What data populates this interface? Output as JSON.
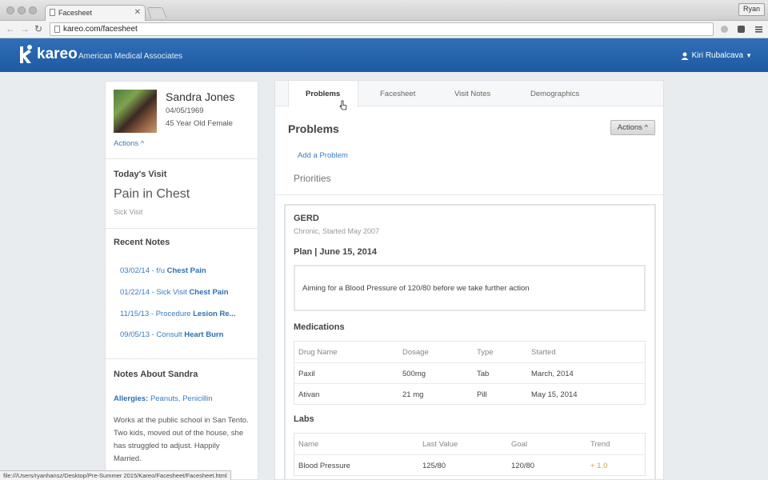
{
  "browser": {
    "tab_title": "Facesheet",
    "url": "kareo.com/facesheet",
    "profile": "Ryan",
    "status_url": "file:///Users/ryanhansz/Desktop/Pre-Summer 2015/Kareo/Facesheet/Facesheet.html"
  },
  "header": {
    "logo": "kareo",
    "practice": "American Medical Associates",
    "user": "Kiri Rubalcava"
  },
  "patient": {
    "name": "Sandra Jones",
    "dob": "04/05/1969",
    "info": "45 Year Old Female",
    "actions_label": "Actions ^"
  },
  "todays_visit": {
    "heading": "Today's Visit",
    "reason": "Pain in Chest",
    "type": "Sick Visit"
  },
  "recent_notes": {
    "heading": "Recent Notes",
    "items": [
      {
        "prefix": "03/02/14 - f/u ",
        "bold": "Chest Pain"
      },
      {
        "prefix": "01/22/14 - Sick Visit ",
        "bold": "Chest Pain"
      },
      {
        "prefix": "11/15/13 - Procedure ",
        "bold": "Lesion Re..."
      },
      {
        "prefix": "09/05/13 - Consult ",
        "bold": "Heart Burn"
      }
    ]
  },
  "notes_about": {
    "heading": "Notes About Sandra",
    "allergies_label": "Allergies:",
    "allergies_value": "Peanuts, Penicillin",
    "text": "Works at the public school in San Tento. Two kids, moved out of the house, she has struggled to adjust. Happily Married."
  },
  "tabs": [
    "Problems",
    "Facesheet",
    "Visit Notes",
    "Demographics"
  ],
  "main": {
    "title": "Problems",
    "actions_label": "Actions ^",
    "add_problem": "Add a Problem",
    "priorities": "Priorities"
  },
  "problem": {
    "name": "GERD",
    "sub": "Chronic, Started May 2007",
    "plan_title": "Plan | June 15, 2014",
    "plan_text": "Aiming for a Blood Pressure of 120/80 before we take further action",
    "medications_title": "Medications",
    "medications_headers": [
      "Drug Name",
      "Dosage",
      "Type",
      "Started"
    ],
    "medications": [
      [
        "Paxil",
        "500mg",
        "Tab",
        "March, 2014"
      ],
      [
        "Ativan",
        "21 mg",
        "Pill",
        "May 15, 2014"
      ]
    ],
    "labs_title": "Labs",
    "labs_headers": [
      "Name",
      "Last Value",
      "Goal",
      "Trend"
    ],
    "labs": [
      [
        "Blood Pressure",
        "125/80",
        "120/80",
        "+ 1.0"
      ]
    ]
  },
  "colors": {
    "brand_blue": "#2f6fb9",
    "link": "#3a7bbf",
    "trend_up": "#c8a64a"
  }
}
